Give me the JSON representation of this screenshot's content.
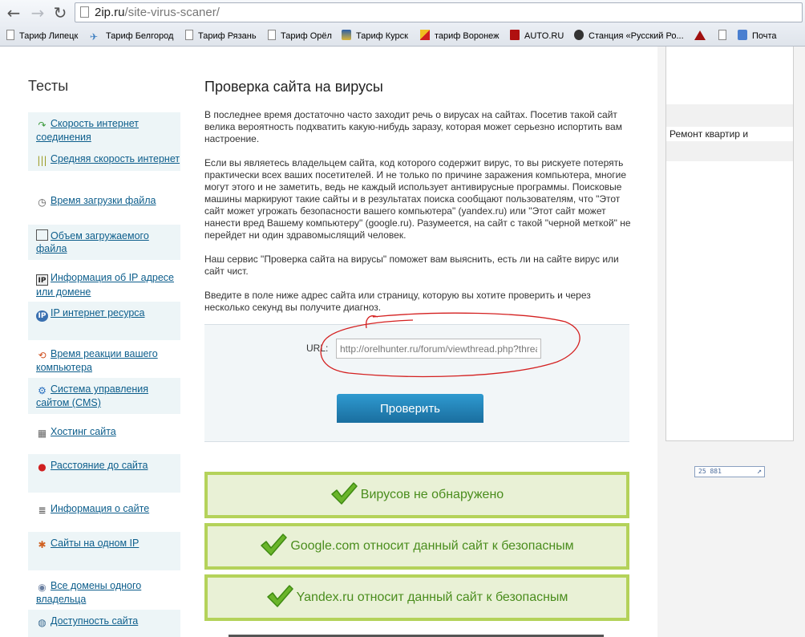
{
  "browser": {
    "url_host": "2ip.ru",
    "url_path": "/site-virus-scaner/",
    "back_glyph": "←",
    "forward_glyph": "→",
    "reload_glyph": "↻",
    "bookmarks": [
      {
        "label": "Тариф Липецк",
        "icon": "page-icon"
      },
      {
        "label": "Тариф Белгород",
        "icon": "bird-icon"
      },
      {
        "label": "Тариф Рязань",
        "icon": "page-icon"
      },
      {
        "label": "Тариф Орёл",
        "icon": "page-icon"
      },
      {
        "label": "Тариф Курск",
        "icon": "coat-of-arms-icon"
      },
      {
        "label": "тариф Воронеж",
        "icon": "flag-icon"
      },
      {
        "label": "AUTO.RU",
        "icon": "auto-icon"
      },
      {
        "label": "Станция «Русский Ро...",
        "icon": "play-icon"
      },
      {
        "label": "",
        "icon": "triangle-icon"
      },
      {
        "label": "",
        "icon": "page-icon"
      },
      {
        "label": "Почта",
        "icon": "mail-icon"
      }
    ]
  },
  "sidebar": {
    "title": "Тесты",
    "items": [
      {
        "label": "Скорость интернет соединения",
        "icon": "speed-icon",
        "glyph": "↷"
      },
      {
        "label": "Средняя скорость интернет",
        "icon": "average-speed-icon",
        "glyph": "|||"
      },
      {
        "label": "Время загрузки файла",
        "icon": "clock-icon",
        "glyph": "◷"
      },
      {
        "label": "Объем загружаемого файла",
        "icon": "volume-icon",
        "glyph": ""
      },
      {
        "label": "Информация об IP адресе или домене",
        "icon": "ip-icon",
        "glyph": "IP"
      },
      {
        "label": "IP интернет ресурса",
        "icon": "ip-resource-icon",
        "glyph": "IP"
      },
      {
        "label": "Время реакции вашего компьютера",
        "icon": "reaction-icon",
        "glyph": "⟲"
      },
      {
        "label": "Система управления сайтом (CMS)",
        "icon": "cms-icon",
        "glyph": "⚙"
      },
      {
        "label": "Хостинг сайта",
        "icon": "hosting-icon",
        "glyph": "▦"
      },
      {
        "label": "Расстояние до сайта",
        "icon": "pin-icon",
        "glyph": "●"
      },
      {
        "label": "Информация о сайте",
        "icon": "info-icon",
        "glyph": "≣"
      },
      {
        "label": "Сайты на одном IP",
        "icon": "sites-icon",
        "glyph": "✱"
      },
      {
        "label": "Все домены одного владельца",
        "icon": "domains-icon",
        "glyph": "◉"
      },
      {
        "label": "Доступность сайта",
        "icon": "availability-icon",
        "glyph": "◍"
      }
    ]
  },
  "main": {
    "title": "Проверка сайта на вирусы",
    "paragraphs": [
      "В последнее время достаточно часто заходит речь о вирусах на сайтах. Посетив такой сайт велика вероятность подхватить какую-нибудь заразу, которая может серьезно испортить вам настроение.",
      "Если вы являетесь владельцем сайта, код которого содержит вирус, то вы рискуете потерять практически всех ваших посетителей. И не только по причине заражения компьютера, многие могут этого и не заметить, ведь не каждый использует антивирусные программы. Поисковые машины маркируют такие сайты и в результатах поиска сообщают пользователям, что \"Этот сайт может угрожать безопасности вашего компьютера\" (yandex.ru) или \"Этот сайт может нанести вред Вашему компьютеру\" (google.ru). Разумеется, на сайт с такой \"черной меткой\" не перейдет ни один здравомыслящий человек.",
      "Наш сервис \"Проверка сайта на вирусы\" поможет вам выяснить, есть ли на сайте вирус или сайт чист.",
      "Введите в поле ниже адрес сайта или страницу, которую вы хотите проверить и через несколько секунд вы получите диагноз."
    ],
    "form": {
      "url_label": "URL:",
      "url_value": "http://orelhunter.ru/forum/viewthread.php?thread_id=",
      "submit_label": "Проверить"
    },
    "results": [
      "Вирусов не обнаружено",
      "Google.com относит данный сайт к безопасным",
      "Yandex.ru относит данный сайт к безопасным"
    ]
  },
  "right": {
    "ad_text": "Ремонт квартир и",
    "counter": "25 881",
    "counter_arrow": "↗"
  },
  "colors": {
    "link": "#0d5e8c",
    "result_border": "#b4d25a",
    "result_text": "#4a8d1d",
    "button": "#1a6e9f",
    "annotation": "#d42020"
  }
}
